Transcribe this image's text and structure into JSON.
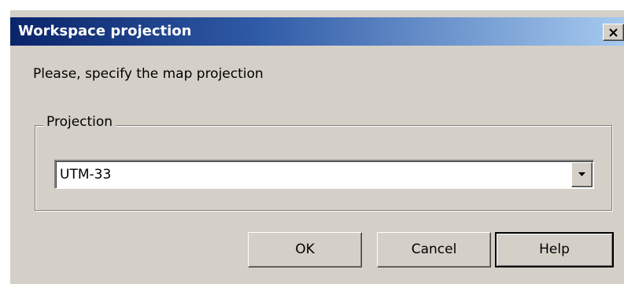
{
  "window": {
    "title": "Workspace projection",
    "close_icon": "close-icon"
  },
  "prompt": "Please, specify the map projection",
  "projection_group": {
    "label": "Projection",
    "selected": "UTM-33",
    "dropdown_icon": "chevron-down-icon"
  },
  "buttons": {
    "ok": "OK",
    "cancel": "Cancel",
    "help": "Help"
  },
  "colors": {
    "title_gradient_start": "#0a246a",
    "title_gradient_end": "#a6caf0",
    "face": "#d4d0c8"
  }
}
